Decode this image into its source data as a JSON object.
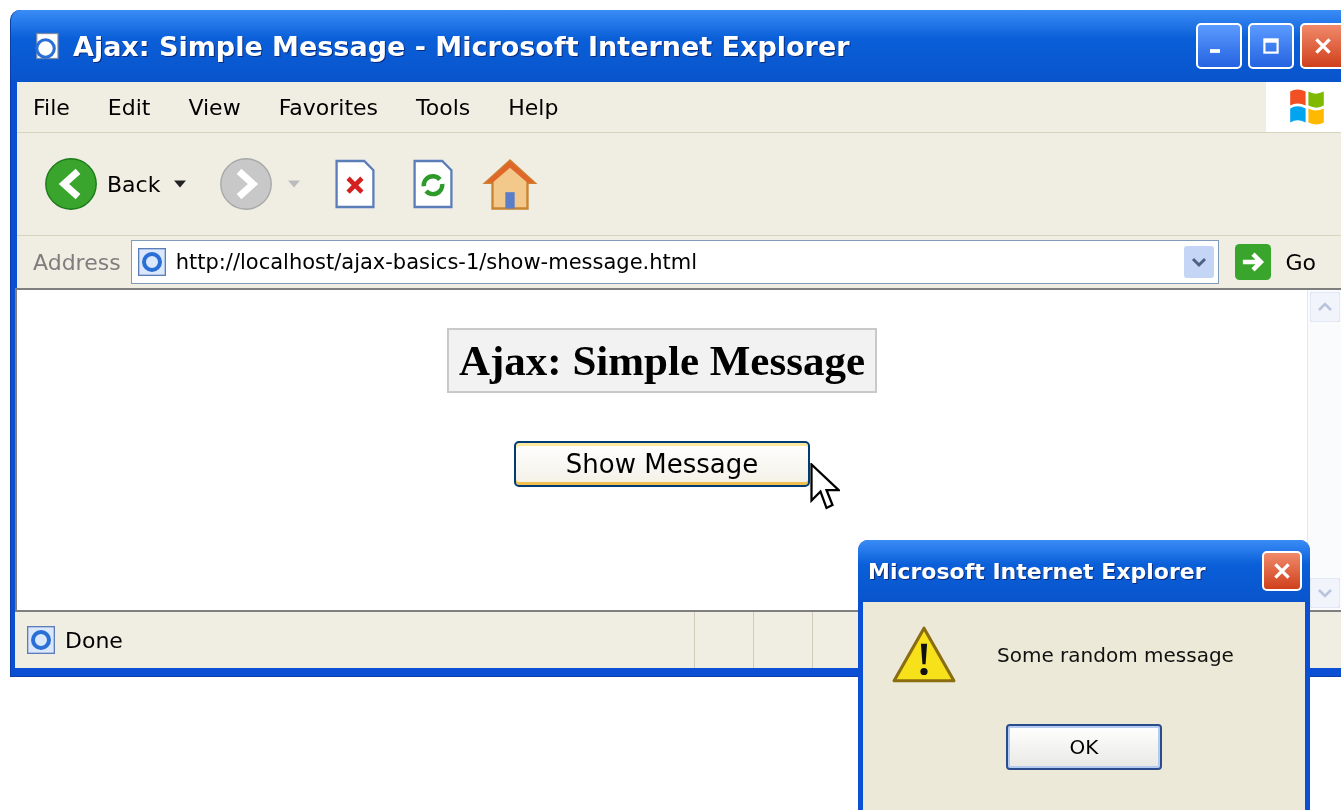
{
  "window": {
    "title": "Ajax: Simple Message - Microsoft Internet Explorer"
  },
  "menu": [
    "File",
    "Edit",
    "View",
    "Favorites",
    "Tools",
    "Help"
  ],
  "toolbar": {
    "back_label": "Back",
    "forward_disabled": true
  },
  "address": {
    "label": "Address",
    "value": "http://localhost/ajax-basics-1/show-message.html",
    "go_label": "Go"
  },
  "page": {
    "heading": "Ajax: Simple Message",
    "button": "Show Message"
  },
  "status_bar": {
    "text": "Done"
  },
  "dialog": {
    "title": "Microsoft Internet Explorer",
    "message": "Some random message",
    "button": "OK"
  }
}
